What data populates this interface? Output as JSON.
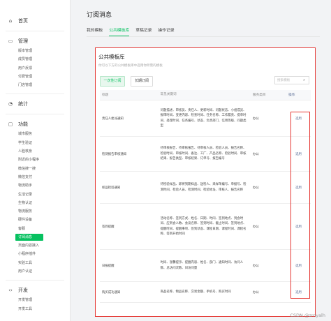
{
  "sidebar": {
    "groups": [
      {
        "label": "首页",
        "icon": "home-icon",
        "items": []
      },
      {
        "label": "管理",
        "icon": "management-icon",
        "items": [
          "版本管理",
          "成员管理",
          "用户反馈",
          "付费管理",
          "门店管理"
        ]
      },
      {
        "label": "统计",
        "icon": "statistics-icon",
        "items": []
      },
      {
        "label": "功能",
        "icon": "function-icon",
        "items": [
          "城市服务",
          "学生验证",
          "人脸核身",
          "附近的小程序",
          "微信搜一搜",
          "微信支付",
          "物流助手",
          "生活记录",
          "生物认证",
          "物流服务",
          "硬件设备",
          "客服",
          "订阅消息",
          "页面内容接入",
          "小程序插件",
          "实验工具",
          "用户认证"
        ]
      },
      {
        "label": "开发",
        "icon": "development-icon",
        "items": [
          "开发管理",
          "开发工具"
        ]
      }
    ],
    "active_item": "订阅消息"
  },
  "main": {
    "title": "订阅消息",
    "tabs": [
      "我的模板",
      "公共模板库",
      "草稿记录",
      "操作记录"
    ],
    "active_tab": "公共模板库"
  },
  "panel": {
    "title": "公共模板库",
    "desc": "你可以下方的公共模板库中选用你所需的模板",
    "btn_once": "一次性订阅",
    "btn_long": "长期订阅",
    "search_placeholder": "搜索模板",
    "columns": [
      "标题",
      "常见关键词",
      "服务类目",
      "操作"
    ],
    "rows": [
      {
        "title": "责任人委派通知",
        "keywords": "问题描述、审核员、责任人、更新时间、问题状态、小组成员、报审时间、变更内容、检查时间、任务名称、工作履责、提单时间、处理时间、任务编号、状态、负责部门、信用等级、问题类型",
        "category": "办公",
        "op": "选用"
      },
      {
        "title": "检测报告审核通知",
        "keywords": "待审核报告、待审核报告、待审核人员、检验人员、报告名称、检验时间、审核时间、备注、工厂、产品名称、检验时间、审核结果、报告类型、审核结果、订单号、报告编号",
        "category": "办公",
        "op": "选用"
      },
      {
        "title": "样品检验通知",
        "keywords": "待检验样品、即将到期样品、送检人、采样单编号、单据号、检测时间、检验人员、检测时间、检验地址、审核人、报告名称",
        "category": "办公",
        "op": "选用"
      },
      {
        "title": "签到提醒",
        "keywords": "活动名称、签到方式、姓名、日期、时间、签到地点、到会时间、应到会人数、会议名称、签到时间、截止时间、签到地点、提醒时间、提醒事项、签到状态、课程日期、课程时间、课程名称、签到开始时间",
        "category": "办公",
        "op": "选用"
      },
      {
        "title": "日报提醒",
        "keywords": "时间、温馨提示、提醒内容、姓名、部门、通知时间、访问人数、总访问次数、日访问量",
        "category": "办公",
        "op": "选用"
      },
      {
        "title": "购买成功通知",
        "keywords": "商品名称、物品名称、交易金额、手机号、购买时间",
        "category": "办公",
        "op": "选用"
      }
    ]
  },
  "watermark": "CSDN @zmyalh",
  "colors": {
    "accent": "#07c160",
    "highlight_red": "#e53935",
    "link": "#576b95"
  }
}
